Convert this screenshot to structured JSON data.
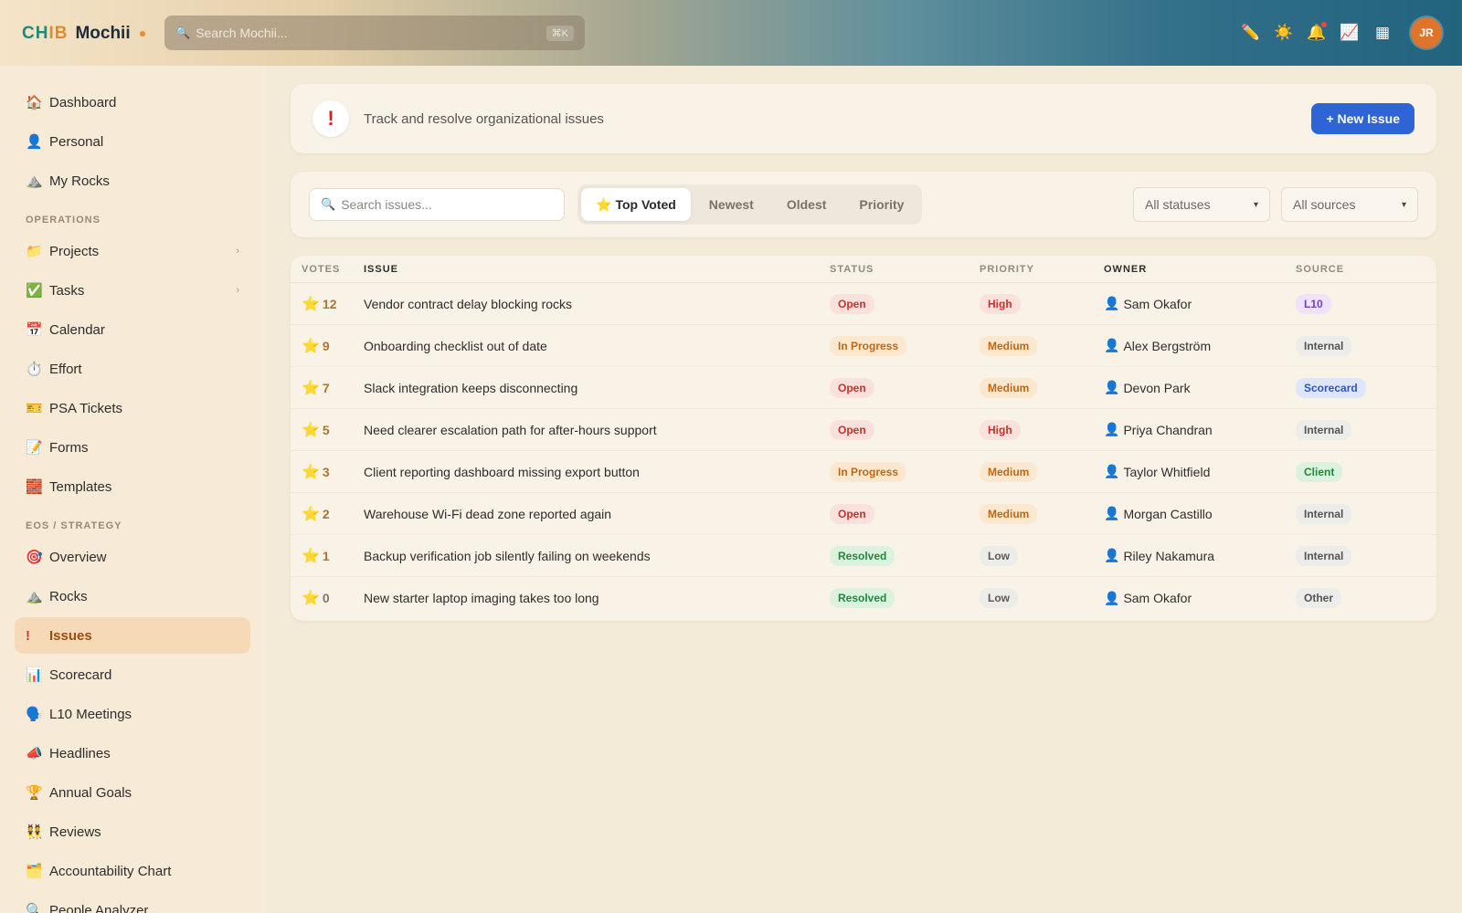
{
  "topbar": {
    "brand_part1": "CH",
    "brand_part2": "IB",
    "brand_name": "Mochii",
    "search_placeholder": "Search Mochii...",
    "search_shortcut": "⌘K",
    "avatar_initials": "JR"
  },
  "sidebar": {
    "items_top": [
      {
        "label": "Dashboard",
        "icon": "🏠"
      },
      {
        "label": "Personal",
        "icon": "👤"
      },
      {
        "label": "My Rocks",
        "icon": "⛰️"
      }
    ],
    "section_operations": "OPERATIONS",
    "items_operations": [
      {
        "label": "Projects",
        "icon": "📁",
        "chevron": "›"
      },
      {
        "label": "Tasks",
        "icon": "✅",
        "chevron": "›"
      },
      {
        "label": "Calendar",
        "icon": "📅"
      },
      {
        "label": "Effort",
        "icon": "⏱️"
      },
      {
        "label": "PSA Tickets",
        "icon": "🎫"
      },
      {
        "label": "Forms",
        "icon": "📝"
      },
      {
        "label": "Templates",
        "icon": "🧱"
      }
    ],
    "section_eos": "EOS / STRATEGY",
    "items_eos": [
      {
        "label": "Overview",
        "icon": "🎯"
      },
      {
        "label": "Rocks",
        "icon": "⛰️"
      },
      {
        "label": "Issues",
        "icon": "!"
      },
      {
        "label": "Scorecard",
        "icon": "📊"
      },
      {
        "label": "L10 Meetings",
        "icon": "🗣️"
      },
      {
        "label": "Headlines",
        "icon": "📣"
      },
      {
        "label": "Annual Goals",
        "icon": "🏆"
      },
      {
        "label": "Reviews",
        "icon": "👯"
      },
      {
        "label": "Accountability Chart",
        "icon": "🗂️"
      },
      {
        "label": "People Analyzer",
        "icon": "🔍"
      }
    ]
  },
  "header": {
    "icon": "!",
    "subtitle": "Track and resolve organizational issues",
    "new_issue_label": "+ New Issue"
  },
  "filters": {
    "search_placeholder": "Search issues...",
    "tabs": [
      {
        "label": "Top Voted",
        "icon": "⭐"
      },
      {
        "label": "Newest"
      },
      {
        "label": "Oldest"
      },
      {
        "label": "Priority"
      }
    ],
    "status_select": "All statuses",
    "source_select": "All sources"
  },
  "table": {
    "columns": [
      "VOTES",
      "ISSUE",
      "STATUS",
      "PRIORITY",
      "OWNER",
      "SOURCE"
    ],
    "rows": [
      {
        "votes": "12",
        "issue": "Vendor contract delay blocking rocks",
        "status": "Open",
        "priority": "High",
        "owner": "Sam Okafor",
        "source": "L10"
      },
      {
        "votes": "9",
        "issue": "Onboarding checklist out of date",
        "status": "In Progress",
        "priority": "Medium",
        "owner": "Alex Bergström",
        "source": "Internal"
      },
      {
        "votes": "7",
        "issue": "Slack integration keeps disconnecting",
        "status": "Open",
        "priority": "Medium",
        "owner": "Devon Park",
        "source": "Scorecard"
      },
      {
        "votes": "5",
        "issue": "Need clearer escalation path for after-hours support",
        "status": "Open",
        "priority": "High",
        "owner": "Priya Chandran",
        "source": "Internal"
      },
      {
        "votes": "3",
        "issue": "Client reporting dashboard missing export button",
        "status": "In Progress",
        "priority": "Medium",
        "owner": "Taylor Whitfield",
        "source": "Client"
      },
      {
        "votes": "2",
        "issue": "Warehouse Wi-Fi dead zone reported again",
        "status": "Open",
        "priority": "Medium",
        "owner": "Morgan Castillo",
        "source": "Internal"
      },
      {
        "votes": "1",
        "issue": "Backup verification job silently failing on weekends",
        "status": "Resolved",
        "priority": "Low",
        "owner": "Riley Nakamura",
        "source": "Internal"
      },
      {
        "votes": "0",
        "issue": "New starter laptop imaging takes too long",
        "status": "Resolved",
        "priority": "Low",
        "owner": "Sam Okafor",
        "source": "Other"
      }
    ]
  },
  "colors": {
    "accent": "#2f64d6",
    "active_nav_bg": "#f6d9b7",
    "active_nav_text": "#9a4d12",
    "brand_teal": "#1f8a7a",
    "brand_orange": "#e08a2d"
  }
}
